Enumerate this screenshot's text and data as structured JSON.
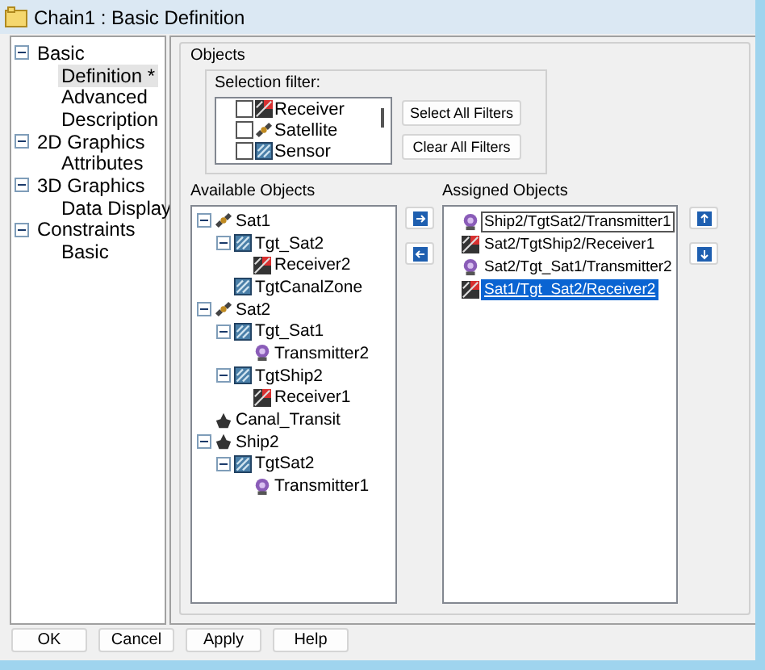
{
  "window": {
    "title": "Chain1 : Basic Definition"
  },
  "nav": [
    {
      "label": "Basic",
      "expanded": true,
      "children": [
        {
          "label": "Definition *",
          "selected": true
        },
        {
          "label": "Advanced",
          "selected": false
        },
        {
          "label": "Description",
          "selected": false
        }
      ]
    },
    {
      "label": "2D Graphics",
      "expanded": true,
      "children": [
        {
          "label": "Attributes",
          "selected": false
        }
      ]
    },
    {
      "label": "3D Graphics",
      "expanded": true,
      "children": [
        {
          "label": "Data Display",
          "selected": false
        }
      ]
    },
    {
      "label": "Constraints",
      "expanded": true,
      "children": [
        {
          "label": "Basic",
          "selected": false
        }
      ]
    }
  ],
  "objects_group": {
    "title": "Objects"
  },
  "selection_filter": {
    "title": "Selection filter:",
    "items": [
      {
        "label": "Receiver",
        "kind": "receiver",
        "checked": false
      },
      {
        "label": "Satellite",
        "kind": "satellite",
        "checked": false
      },
      {
        "label": "Sensor",
        "kind": "target",
        "checked": false
      }
    ],
    "buttons": [
      "Select All Filters",
      "Clear All Filters"
    ]
  },
  "available": {
    "title": "Available Objects",
    "tree": [
      {
        "label": "Sat1",
        "kind": "satellite",
        "expanded": true,
        "children": [
          {
            "label": "Tgt_Sat2",
            "kind": "target",
            "expanded": true,
            "children": [
              {
                "label": "Receiver2",
                "kind": "receiver"
              }
            ]
          },
          {
            "label": "TgtCanalZone",
            "kind": "target"
          }
        ]
      },
      {
        "label": "Sat2",
        "kind": "satellite",
        "expanded": true,
        "children": [
          {
            "label": "Tgt_Sat1",
            "kind": "target",
            "expanded": true,
            "children": [
              {
                "label": "Transmitter2",
                "kind": "transmitter"
              }
            ]
          },
          {
            "label": "TgtShip2",
            "kind": "target",
            "expanded": true,
            "children": [
              {
                "label": "Receiver1",
                "kind": "receiver"
              }
            ]
          }
        ]
      },
      {
        "label": "Canal_Transit",
        "kind": "ship"
      },
      {
        "label": "Ship2",
        "kind": "ship",
        "expanded": true,
        "children": [
          {
            "label": "TgtSat2",
            "kind": "target",
            "expanded": true,
            "children": [
              {
                "label": "Transmitter1",
                "kind": "transmitter"
              }
            ]
          }
        ]
      }
    ]
  },
  "assigned": {
    "title": "Assigned Objects",
    "items": [
      {
        "label": "Ship2/TgtSat2/Transmitter1",
        "kind": "transmitter",
        "focused": true,
        "selected": false
      },
      {
        "label": "Sat2/TgtShip2/Receiver1",
        "kind": "receiver",
        "focused": false,
        "selected": false
      },
      {
        "label": "Sat2/Tgt_Sat1/Transmitter2",
        "kind": "transmitter",
        "focused": false,
        "selected": false
      },
      {
        "label": "Sat1/Tgt_Sat2/Receiver2",
        "kind": "receiver",
        "focused": false,
        "selected": true
      }
    ]
  },
  "footer_buttons": [
    "OK",
    "Cancel",
    "Apply",
    "Help"
  ]
}
